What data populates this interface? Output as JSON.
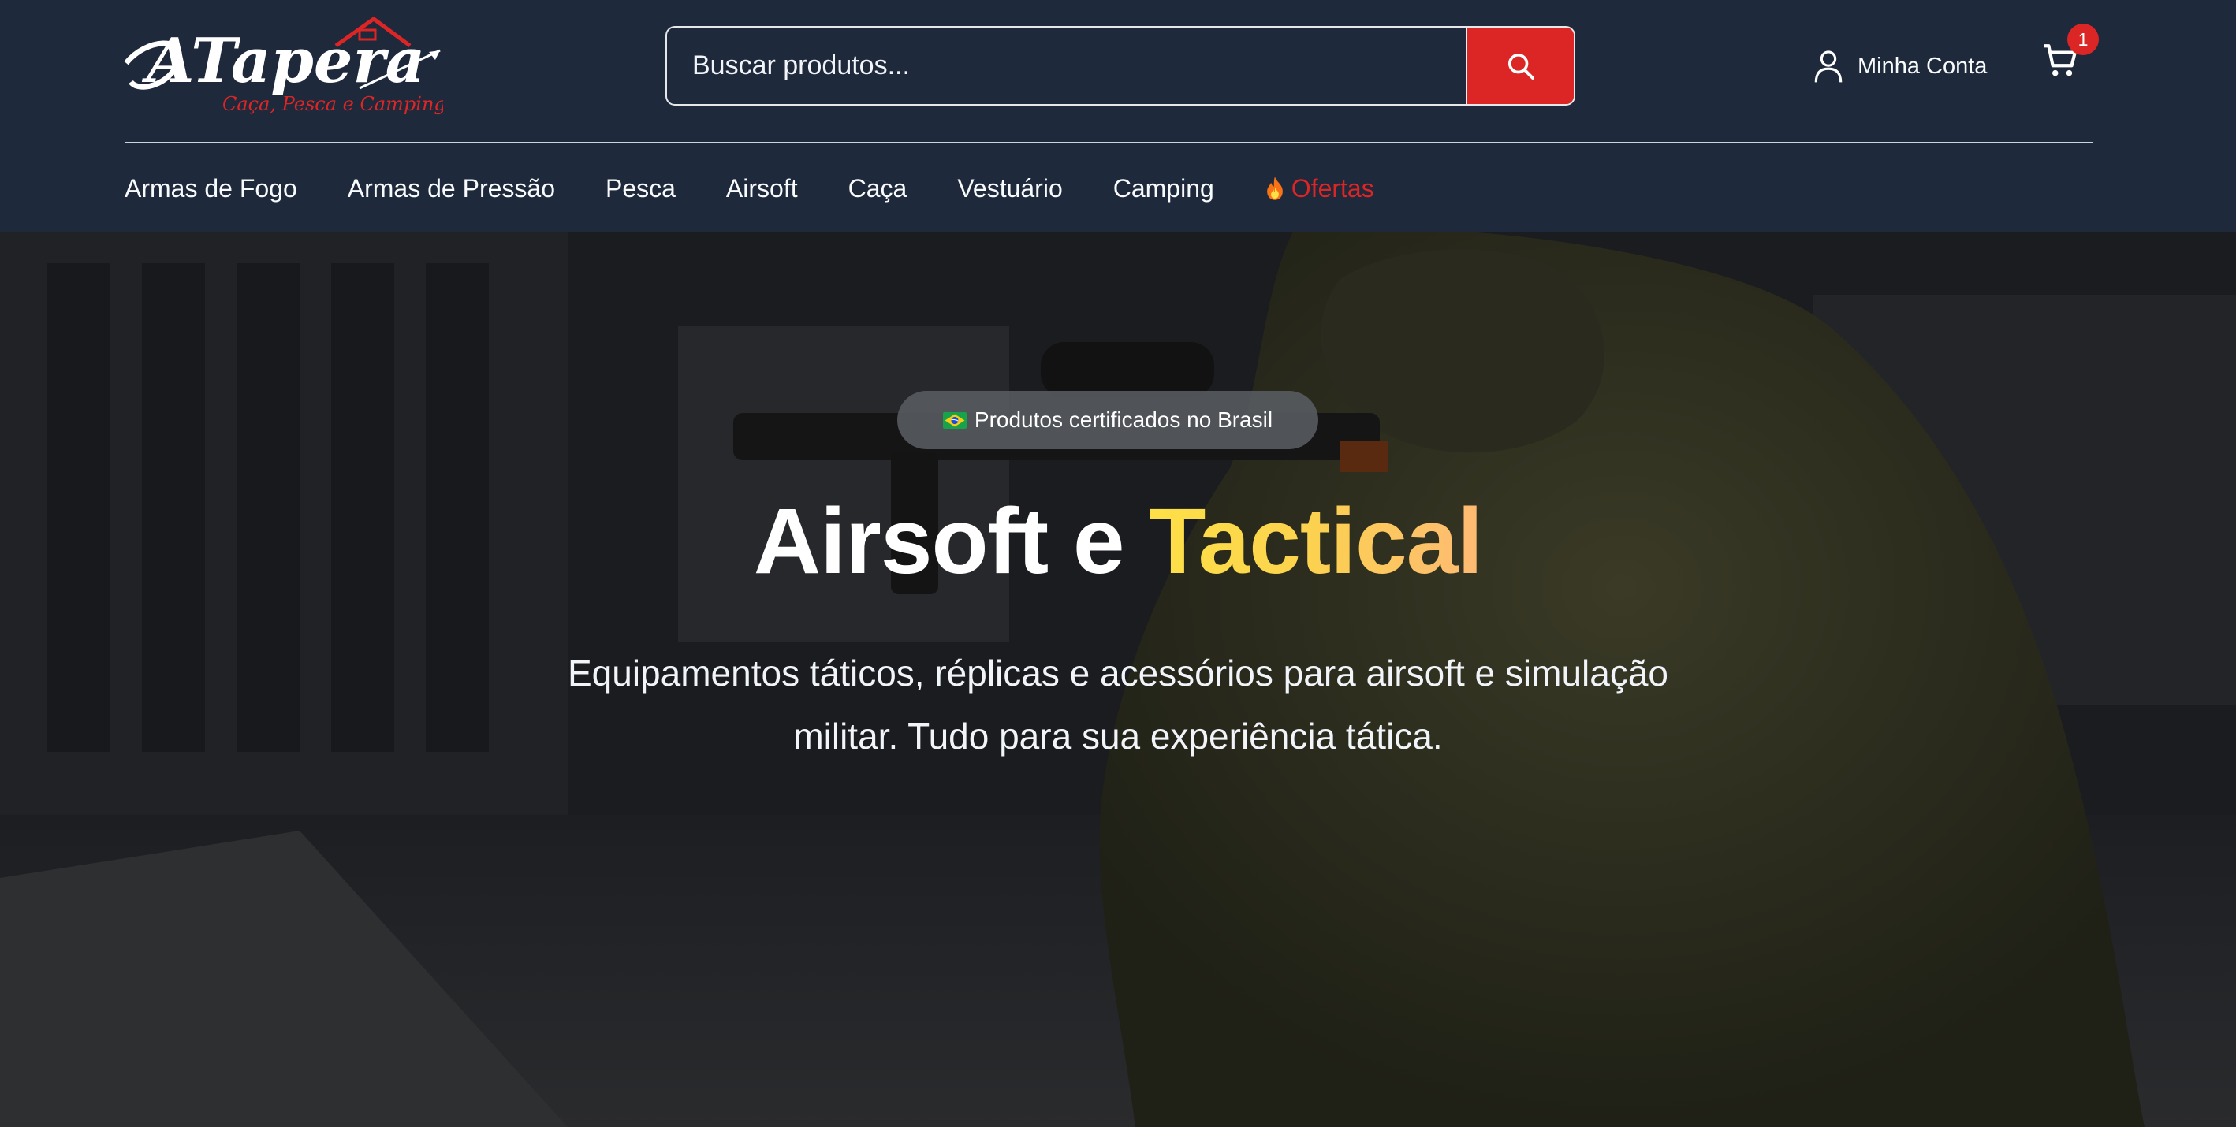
{
  "header": {
    "logo": {
      "wordmark": "ATapera",
      "tagline": "Caça, Pesca e Camping."
    },
    "search": {
      "placeholder": "Buscar produtos..."
    },
    "account_label": "Minha Conta",
    "cart_count": "1"
  },
  "nav": {
    "items": [
      {
        "label": "Armas de Fogo"
      },
      {
        "label": "Armas de Pressão"
      },
      {
        "label": "Pesca"
      },
      {
        "label": "Airsoft"
      },
      {
        "label": "Caça"
      },
      {
        "label": "Vestuário"
      },
      {
        "label": "Camping"
      }
    ],
    "offers": {
      "label": "Ofertas",
      "icon": "flame-icon"
    }
  },
  "hero": {
    "badge_text": "Produtos certificados no Brasil",
    "badge_icon": "brazil-flag-icon",
    "title_main": "Airsoft e",
    "title_accent": "Tactical",
    "subtitle": "Equipamentos táticos, réplicas e acessórios para airsoft e simulação militar. Tudo para sua experiência tática."
  },
  "colors": {
    "header_bg": "#1e293b",
    "brand_red": "#dc2626",
    "accent_gold": "#fcd34d"
  }
}
